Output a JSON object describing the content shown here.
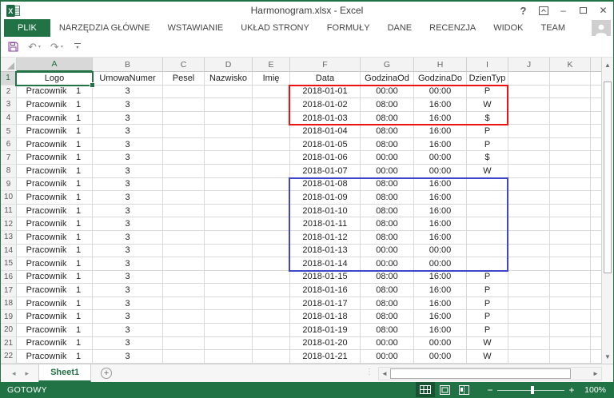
{
  "window": {
    "title": "Harmonogram.xlsx - Excel"
  },
  "ribbon": {
    "file_tab": "PLIK",
    "tabs": [
      "NARZĘDZIA GŁÓWNE",
      "WSTAWIANIE",
      "UKŁAD STRONY",
      "FORMUŁY",
      "DANE",
      "RECENZJA",
      "WIDOK",
      "TEAM"
    ]
  },
  "icons": {
    "help": "?",
    "minimize": "–",
    "close": "✕",
    "undo": "↶",
    "redo": "↷",
    "caret_down": "▾",
    "sheet_prev": "◂",
    "sheet_next": "▸",
    "add_sheet": "+",
    "scroll_up": "▲",
    "scroll_down": "▼",
    "scroll_left": "◄",
    "scroll_right": "►",
    "zoom_out": "−",
    "zoom_in": "+",
    "splitter_dots": "⋮"
  },
  "sheet": {
    "column_letters": [
      "A",
      "B",
      "C",
      "D",
      "E",
      "F",
      "G",
      "H",
      "I",
      "J",
      "K"
    ],
    "header_row": {
      "num": "1",
      "logo": "Logo",
      "umowa": "UmowaNumer",
      "pesel": "Pesel",
      "nazwisko": "Nazwisko",
      "imie": "Imię",
      "data": "Data",
      "godzina_od": "GodzinaOd",
      "godzina_do": "GodzinaDo",
      "dzien_typ": "DzienTyp"
    },
    "rows": [
      {
        "num": "2",
        "logo": "Pracownik",
        "logo_num": "1",
        "umowa": "3",
        "data": "2018-01-01",
        "od": "00:00",
        "do": "00:00",
        "typ": "P"
      },
      {
        "num": "3",
        "logo": "Pracownik",
        "logo_num": "1",
        "umowa": "3",
        "data": "2018-01-02",
        "od": "08:00",
        "do": "16:00",
        "typ": "W"
      },
      {
        "num": "4",
        "logo": "Pracownik",
        "logo_num": "1",
        "umowa": "3",
        "data": "2018-01-03",
        "od": "08:00",
        "do": "16:00",
        "typ": "$"
      },
      {
        "num": "5",
        "logo": "Pracownik",
        "logo_num": "1",
        "umowa": "3",
        "data": "2018-01-04",
        "od": "08:00",
        "do": "16:00",
        "typ": "P"
      },
      {
        "num": "6",
        "logo": "Pracownik",
        "logo_num": "1",
        "umowa": "3",
        "data": "2018-01-05",
        "od": "08:00",
        "do": "16:00",
        "typ": "P"
      },
      {
        "num": "7",
        "logo": "Pracownik",
        "logo_num": "1",
        "umowa": "3",
        "data": "2018-01-06",
        "od": "00:00",
        "do": "00:00",
        "typ": "$"
      },
      {
        "num": "8",
        "logo": "Pracownik",
        "logo_num": "1",
        "umowa": "3",
        "data": "2018-01-07",
        "od": "00:00",
        "do": "00:00",
        "typ": "W"
      },
      {
        "num": "9",
        "logo": "Pracownik",
        "logo_num": "1",
        "umowa": "3",
        "data": "2018-01-08",
        "od": "08:00",
        "do": "16:00",
        "typ": ""
      },
      {
        "num": "10",
        "logo": "Pracownik",
        "logo_num": "1",
        "umowa": "3",
        "data": "2018-01-09",
        "od": "08:00",
        "do": "16:00",
        "typ": ""
      },
      {
        "num": "11",
        "logo": "Pracownik",
        "logo_num": "1",
        "umowa": "3",
        "data": "2018-01-10",
        "od": "08:00",
        "do": "16:00",
        "typ": ""
      },
      {
        "num": "12",
        "logo": "Pracownik",
        "logo_num": "1",
        "umowa": "3",
        "data": "2018-01-11",
        "od": "08:00",
        "do": "16:00",
        "typ": ""
      },
      {
        "num": "13",
        "logo": "Pracownik",
        "logo_num": "1",
        "umowa": "3",
        "data": "2018-01-12",
        "od": "08:00",
        "do": "16:00",
        "typ": ""
      },
      {
        "num": "14",
        "logo": "Pracownik",
        "logo_num": "1",
        "umowa": "3",
        "data": "2018-01-13",
        "od": "00:00",
        "do": "00:00",
        "typ": ""
      },
      {
        "num": "15",
        "logo": "Pracownik",
        "logo_num": "1",
        "umowa": "3",
        "data": "2018-01-14",
        "od": "00:00",
        "do": "00:00",
        "typ": ""
      },
      {
        "num": "16",
        "logo": "Pracownik",
        "logo_num": "1",
        "umowa": "3",
        "data": "2018-01-15",
        "od": "08:00",
        "do": "16:00",
        "typ": "P"
      },
      {
        "num": "17",
        "logo": "Pracownik",
        "logo_num": "1",
        "umowa": "3",
        "data": "2018-01-16",
        "od": "08:00",
        "do": "16:00",
        "typ": "P"
      },
      {
        "num": "18",
        "logo": "Pracownik",
        "logo_num": "1",
        "umowa": "3",
        "data": "2018-01-17",
        "od": "08:00",
        "do": "16:00",
        "typ": "P"
      },
      {
        "num": "19",
        "logo": "Pracownik",
        "logo_num": "1",
        "umowa": "3",
        "data": "2018-01-18",
        "od": "08:00",
        "do": "16:00",
        "typ": "P"
      },
      {
        "num": "20",
        "logo": "Pracownik",
        "logo_num": "1",
        "umowa": "3",
        "data": "2018-01-19",
        "od": "08:00",
        "do": "16:00",
        "typ": "P"
      },
      {
        "num": "21",
        "logo": "Pracownik",
        "logo_num": "1",
        "umowa": "3",
        "data": "2018-01-20",
        "od": "00:00",
        "do": "00:00",
        "typ": "W"
      },
      {
        "num": "22",
        "logo": "Pracownik",
        "logo_num": "1",
        "umowa": "3",
        "data": "2018-01-21",
        "od": "00:00",
        "do": "00:00",
        "typ": "W"
      }
    ],
    "selected_cell": "A1",
    "highlights": [
      {
        "name": "red-box",
        "color": "#ee1111",
        "range": "F2:I4"
      },
      {
        "name": "blue-box",
        "color": "#3f45c8",
        "range": "F9:I15"
      }
    ]
  },
  "sheet_bar": {
    "active_tab": "Sheet1"
  },
  "status_bar": {
    "mode": "GOTOWY",
    "zoom_level": "100%"
  },
  "colors": {
    "accent_green": "#217346"
  }
}
